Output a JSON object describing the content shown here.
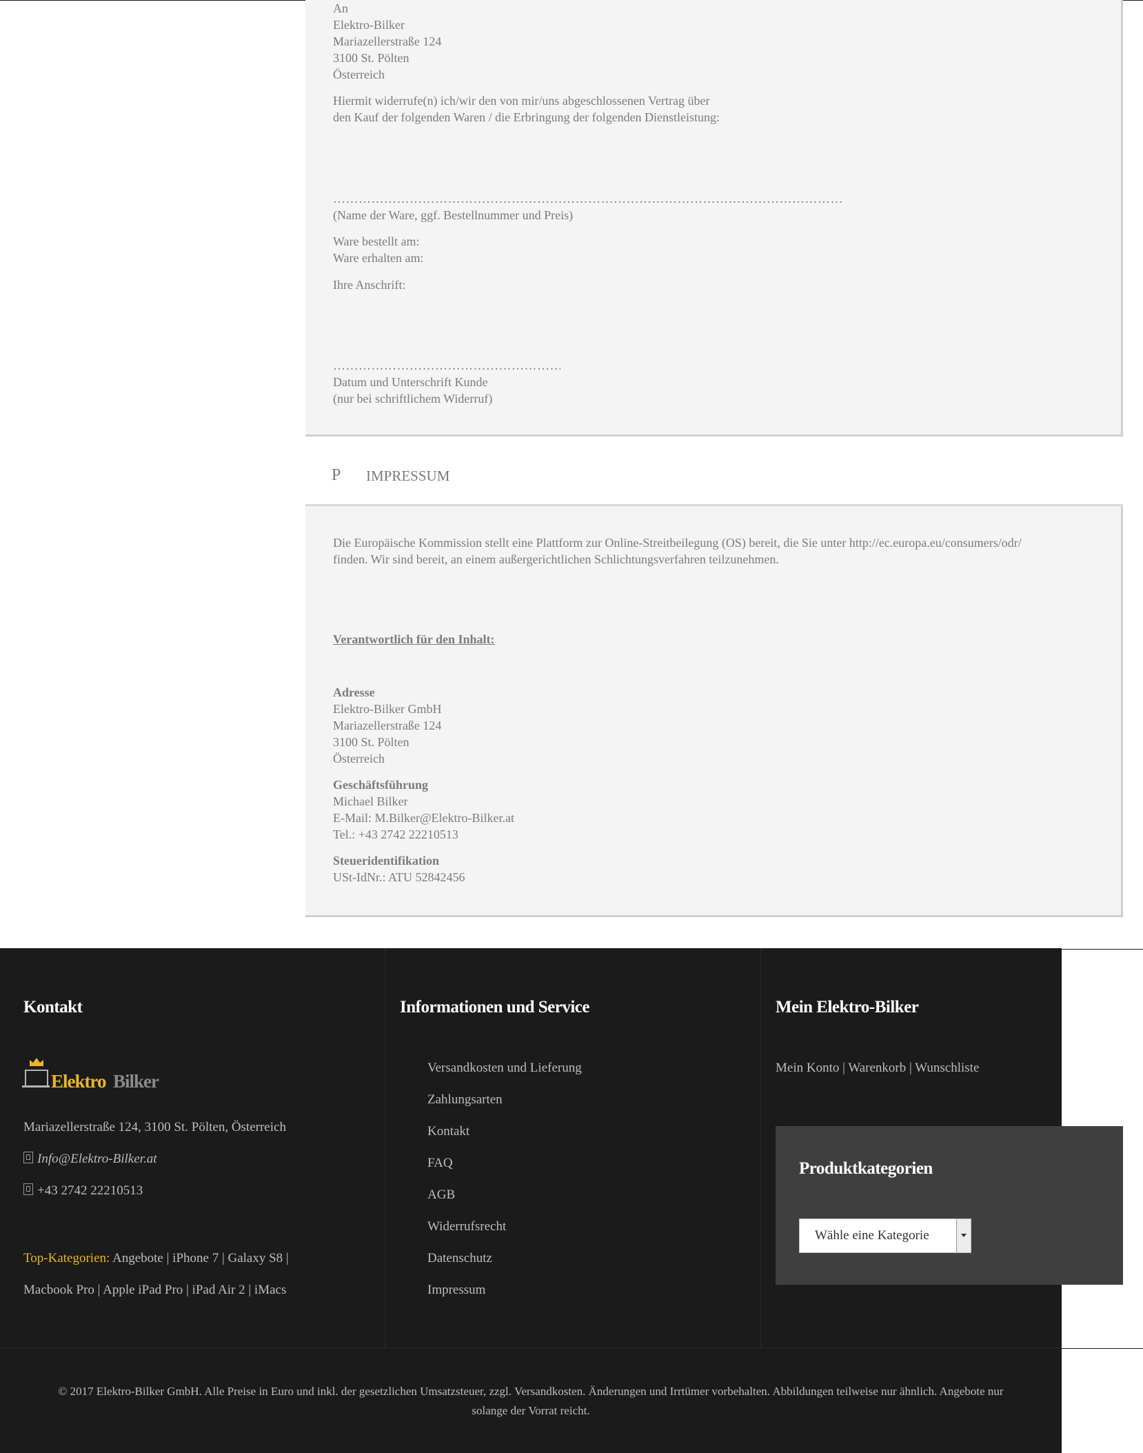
{
  "widerruf": {
    "lines": [
      "An",
      "Elektro-Bilker",
      "Mariazellerstraße 124",
      "3100 St. Pölten",
      "Österreich"
    ],
    "intro1": "Hiermit widerrufe(n) ich/wir den von mir/uns abgeschlossenen Vertrag über",
    "intro2": "den Kauf der folgenden Waren / die Erbringung der folgenden Dienstleistung:",
    "dots_long": "…………………………………………………………………………………………………………",
    "ware_note": "(Name der Ware, ggf. Bestellnummer und Preis)",
    "bestellt": "Ware bestellt am:",
    "erhalten": "Ware erhalten am:",
    "anschrift": "Ihre Anschrift:",
    "dots_short": "……………………………………………………",
    "datum": "Datum und Unterschrift Kunde",
    "datum_note": "(nur bei schriftlichem Widerruf)"
  },
  "impressum": {
    "letter": "P",
    "title": "IMPRESSUM",
    "os1": "Die Europäische Kommission stellt eine Plattform zur Online-Streitbeilegung (OS) bereit, die Sie unter http://ec.europa.eu/consumers/odr/",
    "os2": "finden. Wir sind bereit, an einem außergerichtlichen Schlichtungsverfahren teilzunehmen.",
    "verantwortlich": "Verantwortlich für den Inhalt:",
    "adresse_label": "Adresse",
    "adresse": [
      "Elektro-Bilker GmbH",
      "Mariazellerstraße 124",
      "3100 St. Pölten",
      "Österreich"
    ],
    "gf_label": "Geschäftsführung",
    "gf": [
      "Michael Bilker",
      "E-Mail: M.Bilker@Elektro-Bilker.at",
      "Tel.: +43 2742 22210513"
    ],
    "steuer_label": "Steueridentifikation",
    "steuer": "USt-IdNr.: ATU 52842456"
  },
  "footer": {
    "kontakt": {
      "heading": "Kontakt",
      "logo_text1": "Elektro",
      "logo_text2": "Bilker",
      "address": "Mariazellerstraße 124, 3100 St. Pölten, Österreich",
      "email": "Info@Elektro-Bilker.at",
      "phone": "+43 2742 22210513",
      "top_label": "Top-Kategorien:",
      "top_line1": "Angebote | iPhone 7 | Galaxy S8 |",
      "top_line2": "Macbook Pro | Apple iPad Pro | iPad Air 2 | iMacs"
    },
    "info": {
      "heading": "Informationen und Service",
      "links": [
        "Versandkosten und Lieferung",
        "Zahlungsarten",
        "Kontakt",
        "FAQ",
        "AGB",
        "Widerrufsrecht",
        "Datenschutz",
        "Impressum"
      ]
    },
    "mein": {
      "heading": "Mein Elektro-Bilker",
      "konto": "Mein Konto",
      "sep": " | ",
      "warenkorb": "Warenkorb",
      "wunschliste": "Wunschliste"
    },
    "widget": {
      "heading": "Produktkategorien",
      "select_value": "Wähle eine Kategorie"
    },
    "copyright1": "© 2017 Elektro-Bilker GmbH. Alle Preise in Euro und inkl. der gesetzlichen Umsatzsteuer, zzgl. Versandkosten. Änderungen und Irrtümer vorbehalten. Abbildungen teilweise nur ähnlich. Angebote nur",
    "copyright2": "solange der Vorrat reicht."
  },
  "colors": {
    "accent": "#e8b725",
    "footer_bg": "#1b1b1b",
    "panel_bg": "#f4f4f4",
    "text": "#7b7b7b"
  }
}
